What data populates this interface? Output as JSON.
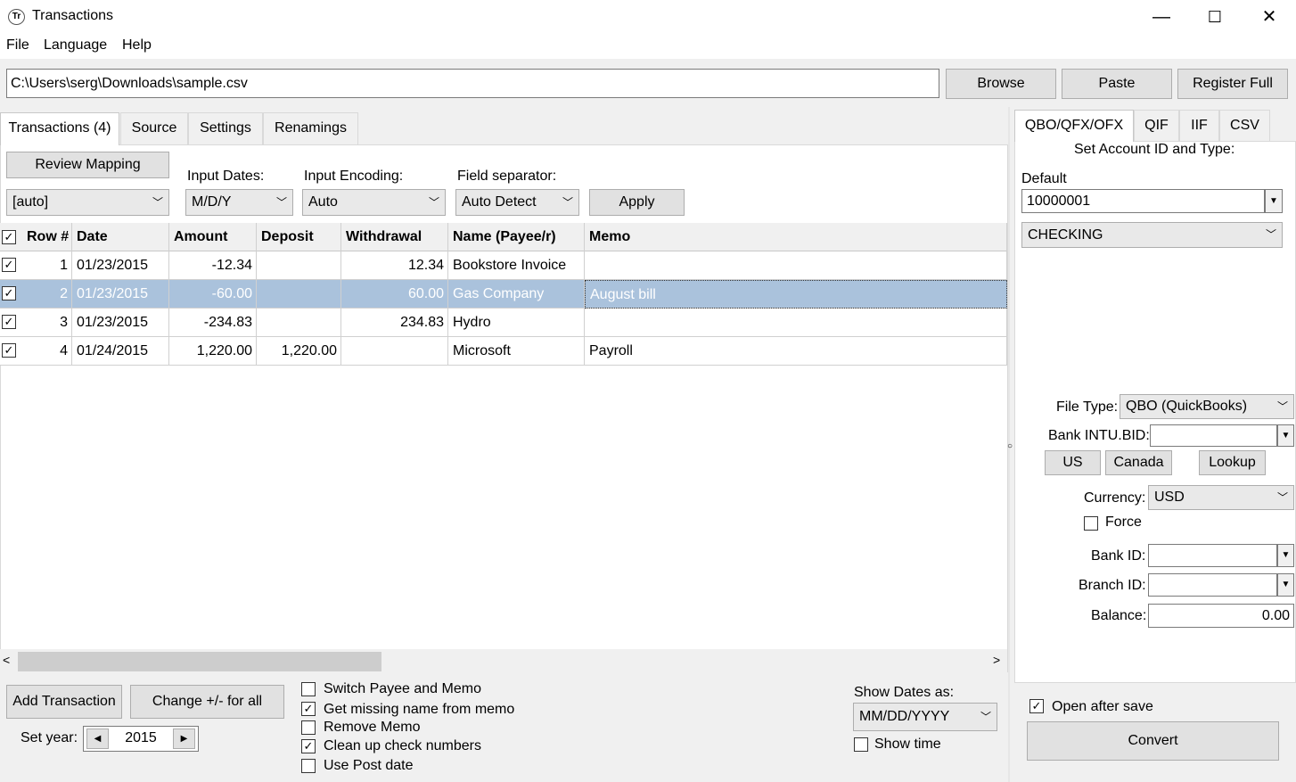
{
  "window": {
    "title": "Transactions",
    "icon_text": "Tr",
    "minimize": "—",
    "maximize": "☐",
    "close": "✕"
  },
  "menu": [
    "File",
    "Language",
    "Help"
  ],
  "path": {
    "value": "C:\\Users\\serg\\Downloads\\sample.csv"
  },
  "top_buttons": {
    "browse": "Browse",
    "paste": "Paste",
    "register": "Register Full"
  },
  "left_tabs": [
    "Transactions (4)",
    "Source",
    "Settings",
    "Renamings"
  ],
  "mapping": {
    "review_label": "Review Mapping",
    "mapping_value": "[auto]",
    "input_dates_label": "Input Dates:",
    "input_dates_value": "M/D/Y",
    "input_encoding_label": "Input Encoding:",
    "input_encoding_value": "Auto",
    "field_sep_label": "Field separator:",
    "field_sep_value": "Auto Detect",
    "apply_label": "Apply"
  },
  "grid": {
    "columns": [
      "Row #",
      "Date",
      "Amount",
      "Deposit",
      "Withdrawal",
      "Name (Payee/r)",
      "Memo"
    ],
    "rows": [
      {
        "row": "1",
        "date": "01/23/2015",
        "amount": "-12.34",
        "deposit": "",
        "withdrawal": "12.34",
        "name": "Bookstore Invoice",
        "memo": ""
      },
      {
        "row": "2",
        "date": "01/23/2015",
        "amount": "-60.00",
        "deposit": "",
        "withdrawal": "60.00",
        "name": "Gas Company",
        "memo": "August bill"
      },
      {
        "row": "3",
        "date": "01/23/2015",
        "amount": "-234.83",
        "deposit": "",
        "withdrawal": "234.83",
        "name": "Hydro",
        "memo": ""
      },
      {
        "row": "4",
        "date": "01/24/2015",
        "amount": "1,220.00",
        "deposit": "1,220.00",
        "withdrawal": "",
        "name": "Microsoft",
        "memo": "Payroll"
      }
    ]
  },
  "bottom": {
    "add_transaction": "Add Transaction",
    "change_sign": "Change +/- for all",
    "set_year_label": "Set year:",
    "year": "2015",
    "options": [
      {
        "label": "Switch Payee and Memo",
        "checked": false
      },
      {
        "label": "Get missing name from memo",
        "checked": true
      },
      {
        "label": "Remove Memo",
        "checked": false
      },
      {
        "label": "Clean up check numbers",
        "checked": true
      },
      {
        "label": "Use Post date",
        "checked": false
      }
    ],
    "show_dates_label": "Show Dates as:",
    "show_dates_value": "MM/DD/YYYY",
    "show_time_label": "Show time"
  },
  "right_panel": {
    "tabs": [
      "QBO/QFX/OFX",
      "QIF",
      "IIF",
      "CSV"
    ],
    "set_account_label": "Set Account ID and Type:",
    "default_label": "Default",
    "account_id": "10000001",
    "account_type": "CHECKING",
    "file_type_label": "File Type:",
    "file_type_value": "QBO (QuickBooks)",
    "bank_intu_label": "Bank INTU.BID:",
    "us_label": "US",
    "canada_label": "Canada",
    "lookup_label": "Lookup",
    "currency_label": "Currency:",
    "currency_value": "USD",
    "force_label": "Force",
    "bank_id_label": "Bank ID:",
    "branch_id_label": "Branch ID:",
    "balance_label": "Balance:",
    "balance_value": "0.00",
    "open_after_save_label": "Open after save",
    "convert_label": "Convert"
  }
}
